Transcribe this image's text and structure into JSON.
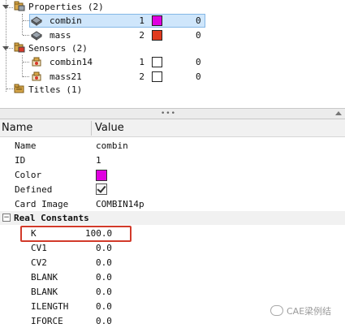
{
  "tree": {
    "properties": {
      "label": "Properties (2)",
      "items": [
        {
          "name": "combin",
          "id": "1",
          "color": "#e000e0",
          "count": "0",
          "selected": true
        },
        {
          "name": "mass",
          "id": "2",
          "color": "#e03a1e",
          "count": "0",
          "selected": false
        }
      ]
    },
    "sensors": {
      "label": "Sensors (2)",
      "items": [
        {
          "name": "combin14",
          "id": "1",
          "color": "#ffffff",
          "count": "0"
        },
        {
          "name": "mass21",
          "id": "2",
          "color": "#ffffff",
          "count": "0"
        }
      ]
    },
    "titles": {
      "label": "Titles (1)"
    }
  },
  "splitter": {
    "grip": "•••"
  },
  "grid": {
    "header": {
      "name": "Name",
      "value": "Value"
    },
    "properties": [
      {
        "name": "Name",
        "value": "combin"
      },
      {
        "name": "ID",
        "value": "1"
      },
      {
        "name": "Color",
        "value": "#e000e0"
      },
      {
        "name": "Defined",
        "value": "checked"
      },
      {
        "name": "Card Image",
        "value": "COMBIN14p"
      }
    ],
    "section": {
      "label": "Real Constants",
      "toggle": "−"
    },
    "real_constants": [
      {
        "name": "K",
        "value": "100.0"
      },
      {
        "name": "CV1",
        "value": "0.0"
      },
      {
        "name": "CV2",
        "value": "0.0"
      },
      {
        "name": "BLANK",
        "value": "0.0"
      },
      {
        "name": "BLANK",
        "value": "0.0"
      },
      {
        "name": "ILENGTH",
        "value": "0.0"
      },
      {
        "name": "IFORCE",
        "value": "0.0"
      }
    ]
  },
  "watermark": {
    "text": "CAE梁例结"
  },
  "colors": {
    "accent_select": "#cfe6fb",
    "highlight_box": "#d23a2a"
  }
}
